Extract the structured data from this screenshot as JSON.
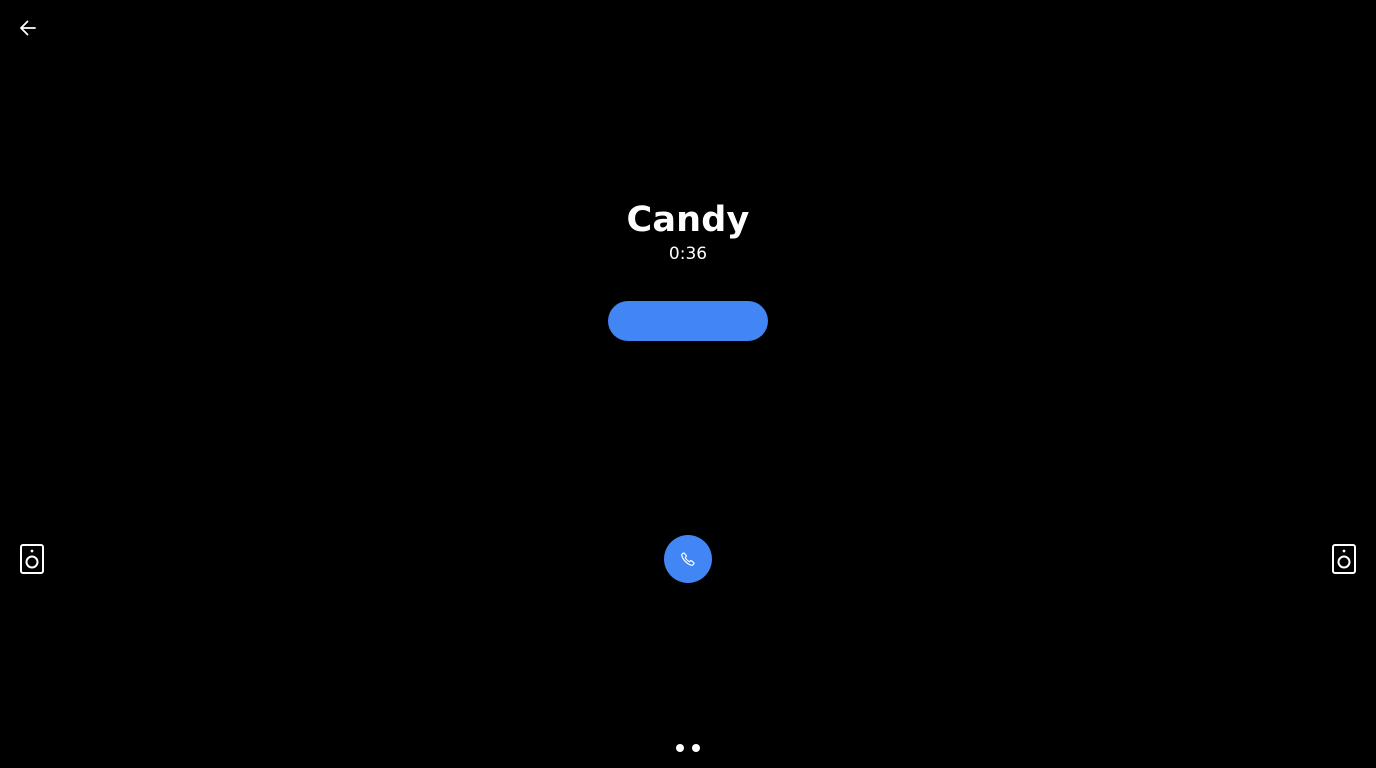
{
  "caller": {
    "name": "Candy",
    "timer": "0:36"
  },
  "icons": {
    "back": "arrow-left-icon",
    "speaker_left": "speaker-icon",
    "speaker_right": "speaker-icon",
    "call": "phone-icon"
  },
  "colors": {
    "background": "#000000",
    "accent": "#4285f4",
    "text": "#ffffff"
  },
  "pager": {
    "page_count": 2
  }
}
